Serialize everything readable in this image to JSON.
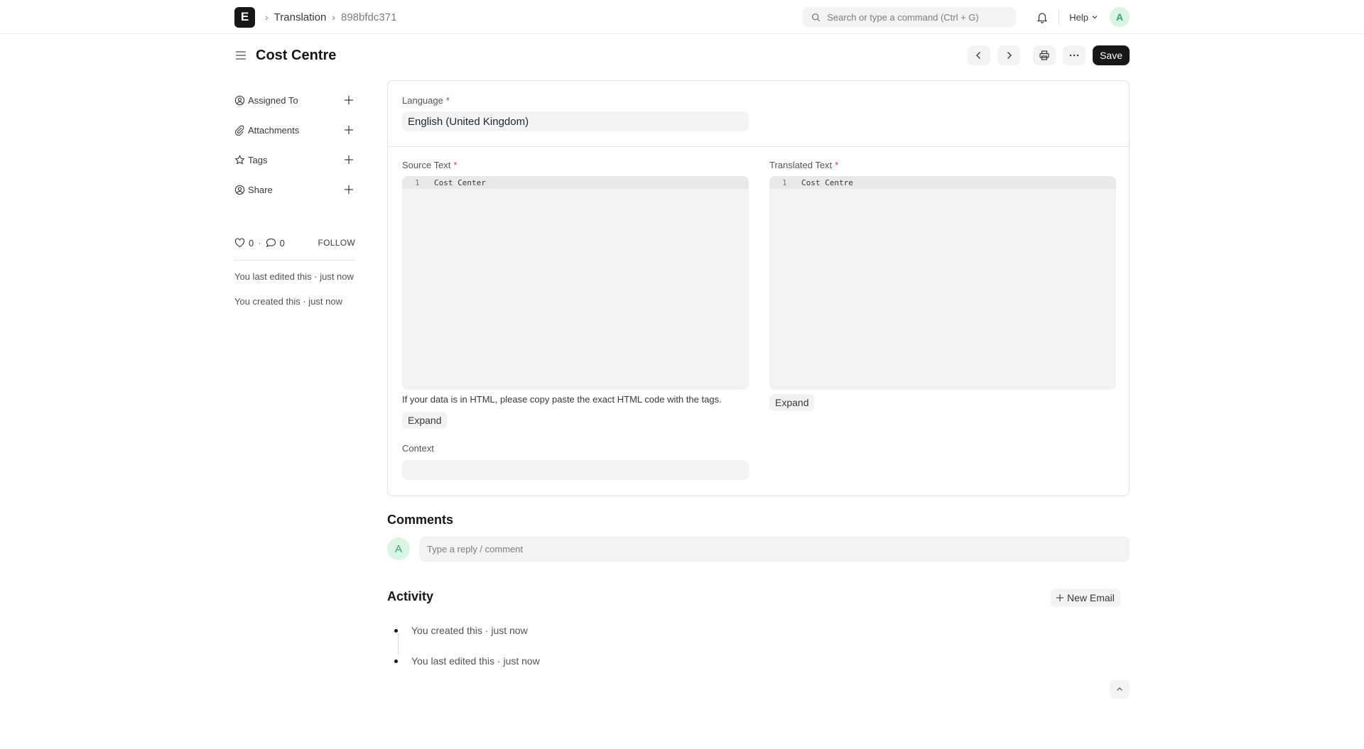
{
  "navbar": {
    "logo_letter": "E",
    "breadcrumb": [
      "Translation",
      "898bfdc371"
    ],
    "search_placeholder": "Search or type a command (Ctrl + G)",
    "help_label": "Help",
    "avatar_letter": "A"
  },
  "page": {
    "title": "Cost Centre",
    "save_label": "Save"
  },
  "sidebar": {
    "items": [
      {
        "label": "Assigned To",
        "icon": "assign-icon"
      },
      {
        "label": "Attachments",
        "icon": "paperclip-icon"
      },
      {
        "label": "Tags",
        "icon": "star-icon"
      },
      {
        "label": "Share",
        "icon": "share-icon"
      }
    ],
    "likes": "0",
    "comments_count": "0",
    "follow_label": "FOLLOW",
    "last_edited": "You last edited this · just now",
    "created": "You created this · just now"
  },
  "form": {
    "language_label": "Language",
    "language_value": "English (United Kingdom)",
    "source_label": "Source Text",
    "source_line_no": "1",
    "source_value": "Cost Center",
    "translated_label": "Translated Text",
    "translated_line_no": "1",
    "translated_value": "Cost Centre",
    "source_description": "If your data is in HTML, please copy paste the exact HTML code with the tags.",
    "expand_label": "Expand",
    "context_label": "Context",
    "context_value": "",
    "required_mark": "*"
  },
  "comments": {
    "title": "Comments",
    "avatar_letter": "A",
    "placeholder": "Type a reply / comment"
  },
  "activity": {
    "title": "Activity",
    "new_email_label": "New Email",
    "items": [
      "You created this · just now",
      "You last edited this · just now"
    ]
  },
  "colors": {
    "primary_button": "#171717",
    "avatar_bg": "#daf5e4",
    "avatar_fg": "#30a66d",
    "required": "#e03636"
  }
}
